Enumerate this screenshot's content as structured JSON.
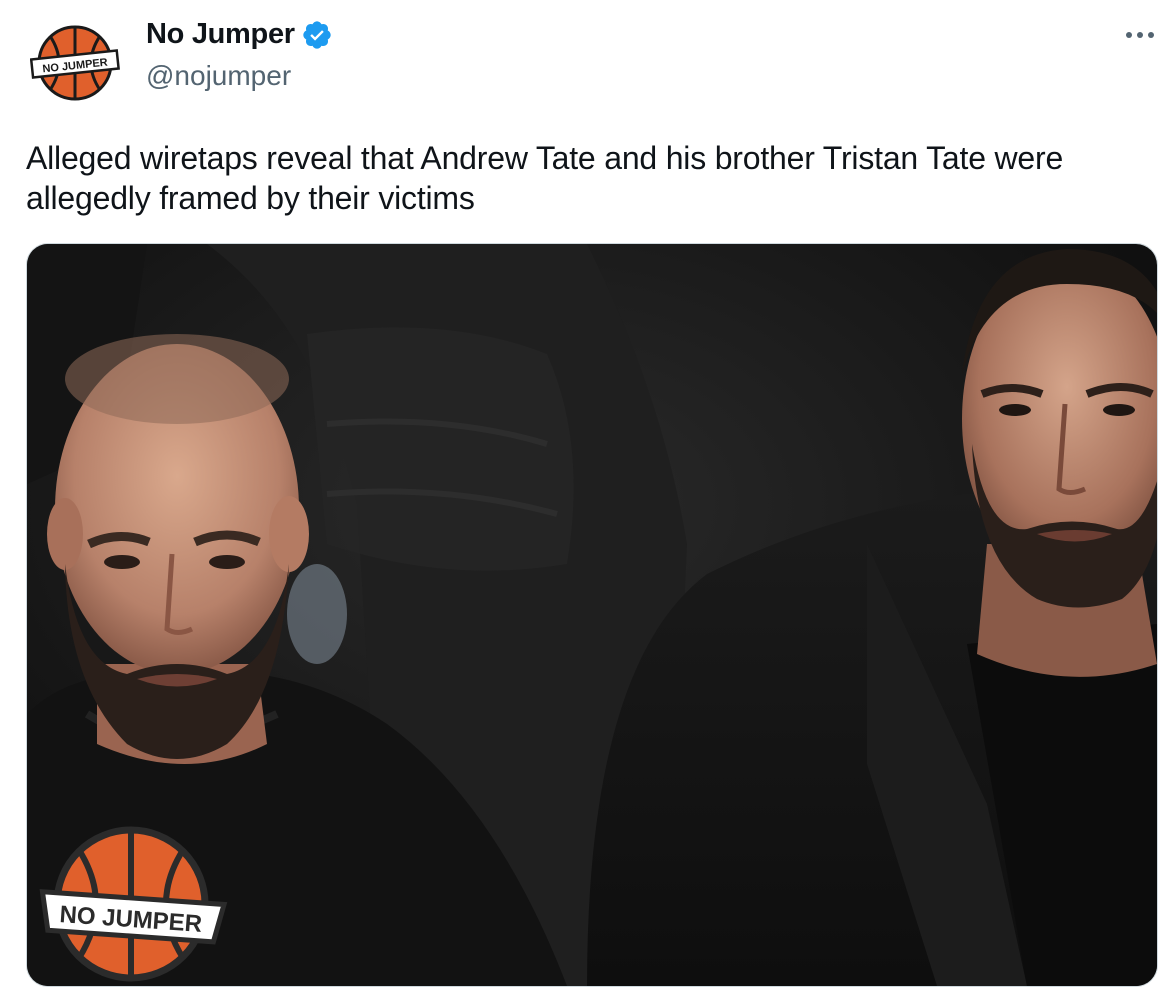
{
  "tweet": {
    "display_name": "No Jumper",
    "handle": "@nojumper",
    "verified": true,
    "text": "Alleged wiretaps reveal that Andrew Tate and his brother Tristan Tate were allegedly framed by their victims",
    "more_icon": "more-horizontal-icon",
    "verified_icon": "verified-badge-icon",
    "avatar_logo_text": "NO JUMPER",
    "media": {
      "watermark_text": "NO JUMPER"
    }
  },
  "colors": {
    "text_primary": "#0f1419",
    "text_secondary": "#536471",
    "verified_blue": "#1d9bf0",
    "basketball_orange": "#e0602c",
    "border": "#cfd9de"
  }
}
